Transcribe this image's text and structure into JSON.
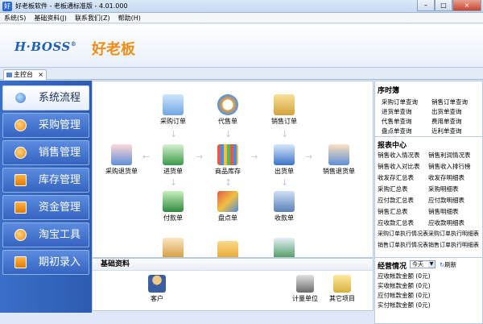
{
  "window": {
    "title": "好老板软件 - 老板通标准版 - 4.01.000",
    "buttons": {
      "minimize": "–",
      "maximize": "□",
      "close": "×"
    }
  },
  "menu": [
    "系统(S)",
    "基础资料(J)",
    "联系我们(Z)",
    "帮助(H)"
  ],
  "banner": {
    "brand_en": "H·BOSS",
    "brand_reg": "®",
    "brand_cn": "好老板"
  },
  "tabs": [
    {
      "label": "主控台",
      "close": "×"
    }
  ],
  "sidebar": [
    {
      "label": "系统流程",
      "icon": "gear-icon"
    },
    {
      "label": "采购管理",
      "icon": "orange-dot-icon"
    },
    {
      "label": "销售管理",
      "icon": "gear-orange-icon"
    },
    {
      "label": "库存管理",
      "icon": "tools-icon"
    },
    {
      "label": "资金管理",
      "icon": "square-icon"
    },
    {
      "label": "淘宝工具",
      "icon": "network-icon"
    },
    {
      "label": "期初录入",
      "icon": "book-icon"
    }
  ],
  "flow": {
    "nodes": {
      "purchase_order": "采购订单",
      "consignment": "代售单",
      "sales_order": "销售订单",
      "purchase_return": "采购退货单",
      "stock_in": "进货单",
      "inventory": "商品库存",
      "stock_out": "出货单",
      "sales_return": "销售退货单",
      "payment": "付款单",
      "stocktake": "盘点单",
      "receipt": "收款单"
    }
  },
  "basic": {
    "title": "基础资料",
    "items": {
      "customer": "客户",
      "unit": "计量单位",
      "other": "其它项目"
    }
  },
  "right": {
    "timing_title": "序时簿",
    "timing_links": [
      [
        "采购订单查询",
        "销售订单查询"
      ],
      [
        "进货单查询",
        "出货单查询"
      ],
      [
        "代售单查询",
        "费用单查询"
      ],
      [
        "盘点单查询",
        "近利单查询"
      ]
    ],
    "report_title": "报表中心",
    "report_links": [
      [
        "销售收入情况表",
        "销售利润情况表"
      ],
      [
        "销售收入对比表",
        "销售收入排行榜"
      ],
      [
        "收发存汇总表",
        "收发存明细表"
      ],
      [
        "采购汇总表",
        "采购明细表"
      ],
      [
        "应付款汇总表",
        "应付款明细表"
      ],
      [
        "销售汇总表",
        "销售明细表"
      ],
      [
        "应收款汇总表",
        "应收款明细表"
      ],
      [
        "采购订单执行情况表",
        "采购订单执行明细表"
      ],
      [
        "销售订单执行情况表",
        "销售订单执行明细表"
      ]
    ],
    "business_title": "经营情况",
    "period": "今天",
    "refresh": "刷新",
    "business_lines": [
      "应收帐款金额 (0元)",
      "实收帐款金额 (0元)",
      "应付帐款金额 (0元)",
      "实付帐款金额 (0元)"
    ]
  }
}
